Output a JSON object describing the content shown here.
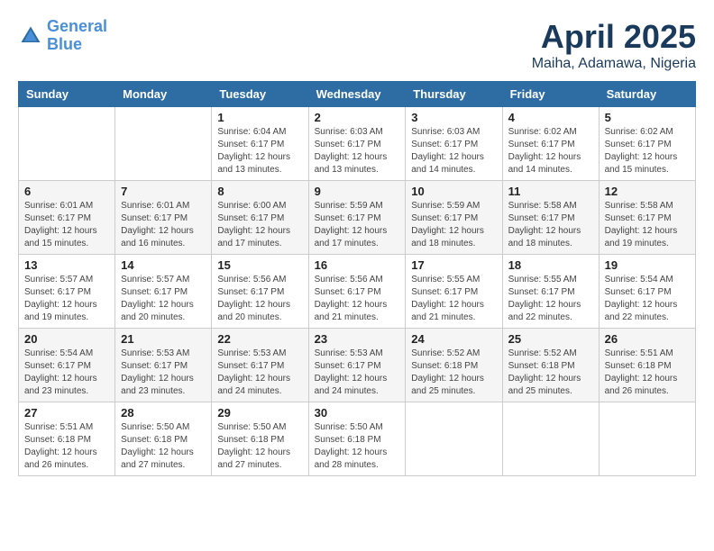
{
  "logo": {
    "line1": "General",
    "line2": "Blue"
  },
  "title": "April 2025",
  "location": "Maiha, Adamawa, Nigeria",
  "days_of_week": [
    "Sunday",
    "Monday",
    "Tuesday",
    "Wednesday",
    "Thursday",
    "Friday",
    "Saturday"
  ],
  "weeks": [
    [
      {
        "day": "",
        "info": ""
      },
      {
        "day": "",
        "info": ""
      },
      {
        "day": "1",
        "info": "Sunrise: 6:04 AM\nSunset: 6:17 PM\nDaylight: 12 hours\nand 13 minutes."
      },
      {
        "day": "2",
        "info": "Sunrise: 6:03 AM\nSunset: 6:17 PM\nDaylight: 12 hours\nand 13 minutes."
      },
      {
        "day": "3",
        "info": "Sunrise: 6:03 AM\nSunset: 6:17 PM\nDaylight: 12 hours\nand 14 minutes."
      },
      {
        "day": "4",
        "info": "Sunrise: 6:02 AM\nSunset: 6:17 PM\nDaylight: 12 hours\nand 14 minutes."
      },
      {
        "day": "5",
        "info": "Sunrise: 6:02 AM\nSunset: 6:17 PM\nDaylight: 12 hours\nand 15 minutes."
      }
    ],
    [
      {
        "day": "6",
        "info": "Sunrise: 6:01 AM\nSunset: 6:17 PM\nDaylight: 12 hours\nand 15 minutes."
      },
      {
        "day": "7",
        "info": "Sunrise: 6:01 AM\nSunset: 6:17 PM\nDaylight: 12 hours\nand 16 minutes."
      },
      {
        "day": "8",
        "info": "Sunrise: 6:00 AM\nSunset: 6:17 PM\nDaylight: 12 hours\nand 17 minutes."
      },
      {
        "day": "9",
        "info": "Sunrise: 5:59 AM\nSunset: 6:17 PM\nDaylight: 12 hours\nand 17 minutes."
      },
      {
        "day": "10",
        "info": "Sunrise: 5:59 AM\nSunset: 6:17 PM\nDaylight: 12 hours\nand 18 minutes."
      },
      {
        "day": "11",
        "info": "Sunrise: 5:58 AM\nSunset: 6:17 PM\nDaylight: 12 hours\nand 18 minutes."
      },
      {
        "day": "12",
        "info": "Sunrise: 5:58 AM\nSunset: 6:17 PM\nDaylight: 12 hours\nand 19 minutes."
      }
    ],
    [
      {
        "day": "13",
        "info": "Sunrise: 5:57 AM\nSunset: 6:17 PM\nDaylight: 12 hours\nand 19 minutes."
      },
      {
        "day": "14",
        "info": "Sunrise: 5:57 AM\nSunset: 6:17 PM\nDaylight: 12 hours\nand 20 minutes."
      },
      {
        "day": "15",
        "info": "Sunrise: 5:56 AM\nSunset: 6:17 PM\nDaylight: 12 hours\nand 20 minutes."
      },
      {
        "day": "16",
        "info": "Sunrise: 5:56 AM\nSunset: 6:17 PM\nDaylight: 12 hours\nand 21 minutes."
      },
      {
        "day": "17",
        "info": "Sunrise: 5:55 AM\nSunset: 6:17 PM\nDaylight: 12 hours\nand 21 minutes."
      },
      {
        "day": "18",
        "info": "Sunrise: 5:55 AM\nSunset: 6:17 PM\nDaylight: 12 hours\nand 22 minutes."
      },
      {
        "day": "19",
        "info": "Sunrise: 5:54 AM\nSunset: 6:17 PM\nDaylight: 12 hours\nand 22 minutes."
      }
    ],
    [
      {
        "day": "20",
        "info": "Sunrise: 5:54 AM\nSunset: 6:17 PM\nDaylight: 12 hours\nand 23 minutes."
      },
      {
        "day": "21",
        "info": "Sunrise: 5:53 AM\nSunset: 6:17 PM\nDaylight: 12 hours\nand 23 minutes."
      },
      {
        "day": "22",
        "info": "Sunrise: 5:53 AM\nSunset: 6:17 PM\nDaylight: 12 hours\nand 24 minutes."
      },
      {
        "day": "23",
        "info": "Sunrise: 5:53 AM\nSunset: 6:17 PM\nDaylight: 12 hours\nand 24 minutes."
      },
      {
        "day": "24",
        "info": "Sunrise: 5:52 AM\nSunset: 6:18 PM\nDaylight: 12 hours\nand 25 minutes."
      },
      {
        "day": "25",
        "info": "Sunrise: 5:52 AM\nSunset: 6:18 PM\nDaylight: 12 hours\nand 25 minutes."
      },
      {
        "day": "26",
        "info": "Sunrise: 5:51 AM\nSunset: 6:18 PM\nDaylight: 12 hours\nand 26 minutes."
      }
    ],
    [
      {
        "day": "27",
        "info": "Sunrise: 5:51 AM\nSunset: 6:18 PM\nDaylight: 12 hours\nand 26 minutes."
      },
      {
        "day": "28",
        "info": "Sunrise: 5:50 AM\nSunset: 6:18 PM\nDaylight: 12 hours\nand 27 minutes."
      },
      {
        "day": "29",
        "info": "Sunrise: 5:50 AM\nSunset: 6:18 PM\nDaylight: 12 hours\nand 27 minutes."
      },
      {
        "day": "30",
        "info": "Sunrise: 5:50 AM\nSunset: 6:18 PM\nDaylight: 12 hours\nand 28 minutes."
      },
      {
        "day": "",
        "info": ""
      },
      {
        "day": "",
        "info": ""
      },
      {
        "day": "",
        "info": ""
      }
    ]
  ]
}
